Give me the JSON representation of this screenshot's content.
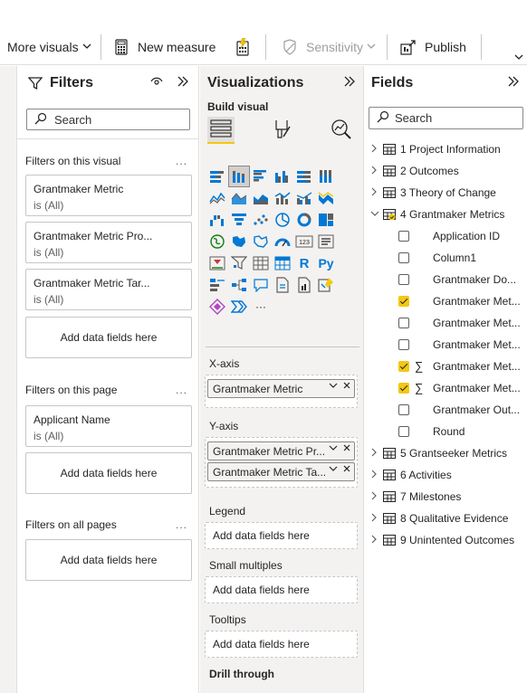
{
  "ribbon": {
    "more_visuals": "More visuals",
    "new_measure": "New measure",
    "sensitivity": "Sensitivity",
    "publish": "Publish"
  },
  "filters": {
    "title": "Filters",
    "search_placeholder": "Search",
    "on_visual_label": "Filters on this visual",
    "on_page_label": "Filters on this page",
    "all_pages_label": "Filters on all pages",
    "more": "...",
    "visual_cards": [
      {
        "name": "Grantmaker Metric",
        "state": "is (All)"
      },
      {
        "name": "Grantmaker Metric Pro...",
        "state": "is (All)"
      },
      {
        "name": "Grantmaker Metric Tar...",
        "state": "is (All)"
      }
    ],
    "page_cards": [
      {
        "name": "Applicant Name",
        "state": "is (All)"
      }
    ],
    "add_fields": "Add data fields here"
  },
  "visualizations": {
    "title": "Visualizations",
    "build_visual": "Build visual",
    "more_icons": "···",
    "x_axis": {
      "label": "X-axis",
      "fields": [
        "Grantmaker Metric"
      ]
    },
    "y_axis": {
      "label": "Y-axis",
      "fields": [
        "Grantmaker Metric Pr...",
        "Grantmaker Metric Ta..."
      ]
    },
    "legend": {
      "label": "Legend",
      "placeholder": "Add data fields here"
    },
    "small_multiples": {
      "label": "Small multiples",
      "placeholder": "Add data fields here"
    },
    "tooltips": {
      "label": "Tooltips",
      "placeholder": "Add data fields here"
    },
    "drill_through": "Drill through",
    "r_icon": "R",
    "py_icon": "Py",
    "num_icon": "123"
  },
  "fields": {
    "title": "Fields",
    "search_placeholder": "Search",
    "tables": [
      {
        "name": "1 Project Information",
        "expanded": false
      },
      {
        "name": "2 Outcomes",
        "expanded": false
      },
      {
        "name": "3 Theory of Change",
        "expanded": false
      },
      {
        "name": "4 Grantmaker Metrics",
        "expanded": true
      },
      {
        "name": "5 Grantseeker Metrics",
        "expanded": false
      },
      {
        "name": "6 Activities",
        "expanded": false
      },
      {
        "name": "7 Milestones",
        "expanded": false
      },
      {
        "name": "8 Qualitative Evidence",
        "expanded": false
      },
      {
        "name": "9 Unintented Outcomes",
        "expanded": false
      }
    ],
    "grantmaker_fields": [
      {
        "name": "Application ID",
        "checked": false,
        "sigma": false
      },
      {
        "name": "Column1",
        "checked": false,
        "sigma": false
      },
      {
        "name": "Grantmaker Do...",
        "checked": false,
        "sigma": false
      },
      {
        "name": "Grantmaker Met...",
        "checked": true,
        "sigma": false
      },
      {
        "name": "Grantmaker Met...",
        "checked": false,
        "sigma": false
      },
      {
        "name": "Grantmaker Met...",
        "checked": false,
        "sigma": false
      },
      {
        "name": "Grantmaker Met...",
        "checked": true,
        "sigma": true
      },
      {
        "name": "Grantmaker Met...",
        "checked": true,
        "sigma": true
      },
      {
        "name": "Grantmaker Out...",
        "checked": false,
        "sigma": false
      },
      {
        "name": "Round",
        "checked": false,
        "sigma": false
      }
    ]
  },
  "colors": {
    "accent_yellow": "#f2c811",
    "icon_blue": "#0078d4"
  }
}
